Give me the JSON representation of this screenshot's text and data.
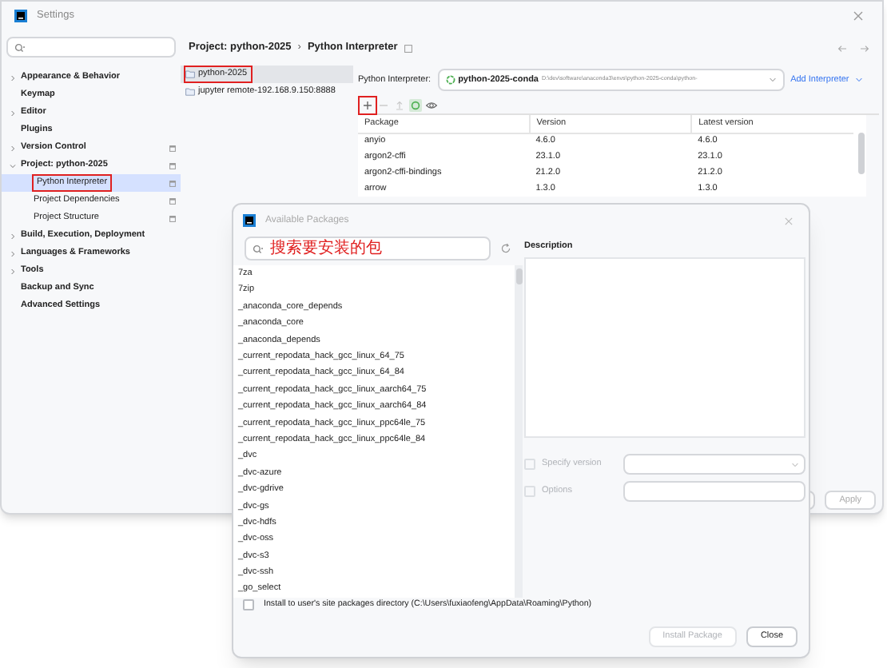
{
  "window": {
    "title": "Settings"
  },
  "sidebar": {
    "items": [
      {
        "label": "Appearance & Behavior",
        "expandable": true,
        "expanded": false,
        "scoped": false,
        "selected": false,
        "annotated": false
      },
      {
        "label": "Keymap",
        "expandable": false,
        "scoped": false,
        "selected": false,
        "annotated": false
      },
      {
        "label": "Editor",
        "expandable": true,
        "expanded": false,
        "scoped": false,
        "selected": false,
        "annotated": false
      },
      {
        "label": "Plugins",
        "expandable": false,
        "scoped": false,
        "selected": false,
        "annotated": false
      },
      {
        "label": "Version Control",
        "expandable": true,
        "expanded": false,
        "scoped": true,
        "selected": false,
        "annotated": false
      },
      {
        "label": "Project: python-2025",
        "expandable": true,
        "expanded": true,
        "scoped": true,
        "selected": false,
        "annotated": false,
        "children": [
          {
            "label": "Python Interpreter",
            "expandable": false,
            "scoped": true,
            "selected": true,
            "annotated": true
          },
          {
            "label": "Project Dependencies",
            "expandable": false,
            "scoped": true,
            "selected": false,
            "annotated": false
          },
          {
            "label": "Project Structure",
            "expandable": false,
            "scoped": true,
            "selected": false,
            "annotated": false
          }
        ]
      },
      {
        "label": "Build, Execution, Deployment",
        "expandable": true,
        "expanded": false,
        "scoped": false,
        "selected": false,
        "annotated": false
      },
      {
        "label": "Languages & Frameworks",
        "expandable": true,
        "expanded": false,
        "scoped": false,
        "selected": false,
        "annotated": false
      },
      {
        "label": "Tools",
        "expandable": true,
        "expanded": false,
        "scoped": false,
        "selected": false,
        "annotated": false
      },
      {
        "label": "Backup and Sync",
        "expandable": false,
        "scoped": false,
        "selected": false,
        "annotated": false
      },
      {
        "label": "Advanced Settings",
        "expandable": false,
        "scoped": false,
        "selected": false,
        "annotated": false
      }
    ]
  },
  "breadcrumb": {
    "items": [
      "Project: python-2025",
      "Python Interpreter"
    ],
    "separator": "›"
  },
  "interpreters": [
    {
      "name": "python-2025",
      "selected": true,
      "annotated": true
    },
    {
      "name": "jupyter remote-192.168.9.150:8888",
      "selected": false,
      "annotated": false
    }
  ],
  "interpreter_field": {
    "label": "Python Interpreter:",
    "name": "python-2025-conda",
    "path": "D:\\dev\\software\\anaconda3\\envs\\python-2025-conda\\python-"
  },
  "add_interpreter": "Add Interpreter",
  "toolbar": [
    {
      "kind": "add",
      "disabled": false,
      "annotated": true
    },
    {
      "kind": "remove",
      "disabled": true,
      "annotated": false
    },
    {
      "kind": "upgrade",
      "disabled": true,
      "annotated": false
    },
    {
      "kind": "refresh",
      "disabled": false,
      "annotated": false
    },
    {
      "kind": "show",
      "disabled": false,
      "annotated": false
    }
  ],
  "packages_table": {
    "columns": [
      "Package",
      "Version",
      "Latest version"
    ],
    "rows": [
      [
        "anyio",
        "4.6.0",
        "4.6.0"
      ],
      [
        "argon2-cffi",
        "23.1.0",
        "23.1.0"
      ],
      [
        "argon2-cffi-bindings",
        "21.2.0",
        "21.2.0"
      ],
      [
        "arrow",
        "1.3.0",
        "1.3.0"
      ]
    ]
  },
  "settings_buttons": [
    {
      "label": "Apply",
      "disabled": true
    }
  ],
  "dialog": {
    "title": "Available Packages",
    "search": {
      "value": "搜索要安装的包",
      "annotated": true
    },
    "packages": [
      "7za",
      "7zip",
      "_anaconda_core_depends",
      "_anaconda_core",
      "_anaconda_depends",
      "_current_repodata_hack_gcc_linux_64_75",
      "_current_repodata_hack_gcc_linux_64_84",
      "_current_repodata_hack_gcc_linux_aarch64_75",
      "_current_repodata_hack_gcc_linux_aarch64_84",
      "_current_repodata_hack_gcc_linux_ppc64le_75",
      "_current_repodata_hack_gcc_linux_ppc64le_84",
      "_dvc",
      "_dvc-azure",
      "_dvc-gdrive",
      "_dvc-gs",
      "_dvc-hdfs",
      "_dvc-oss",
      "_dvc-s3",
      "_dvc-ssh",
      "_go_select"
    ],
    "description_label": "Description",
    "options": [
      {
        "kind": "select",
        "label": "Specify version",
        "checked": false,
        "disabled": true
      },
      {
        "kind": "text",
        "label": "Options",
        "checked": false,
        "disabled": true
      }
    ],
    "install_to_user": {
      "label": "Install to user's site packages directory (C:\\Users\\fuxiaofeng\\AppData\\Roaming\\Python)",
      "checked": false
    },
    "buttons": [
      {
        "label": "Install Package",
        "disabled": true
      },
      {
        "label": "Close",
        "disabled": false
      }
    ]
  }
}
